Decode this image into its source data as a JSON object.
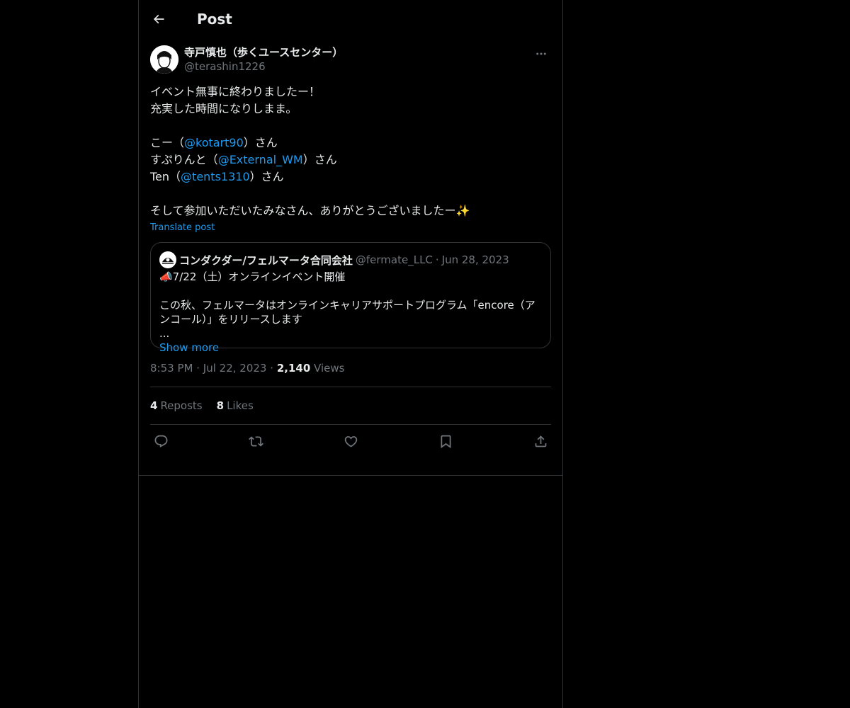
{
  "header": {
    "title": "Post"
  },
  "post": {
    "author": {
      "display_name": "寺戸慎也（歩くユースセンター）",
      "handle": "@terashin1226"
    },
    "body": {
      "line1": "イベント無事に終わりましたー！",
      "line2": "充実した時間になりしまま。",
      "thanks": [
        {
          "prefix": "こー（",
          "mention": "@kotart90",
          "suffix": "）さん"
        },
        {
          "prefix": "すぷりんと（",
          "mention": "@External_WM",
          "suffix": "）さん"
        },
        {
          "prefix": "Ten（",
          "mention": "@tents1310",
          "suffix": "）さん"
        }
      ],
      "closing": "そして参加いただいたみなさん、ありがとうございましたー✨"
    },
    "translate_label": "Translate post",
    "quote": {
      "name": "コンダクダー/フェルマータ合同会社",
      "handle": "@fermate_LLC",
      "separator": "·",
      "date": "Jun 28, 2023",
      "lines": [
        "📣7/22（土）オンラインイベント開催",
        "",
        "この秋、フェルマータはオンラインキャリアサポートプログラム「encore（ア",
        "ンコール）」をリリースします",
        "..."
      ],
      "show_more": "Show more"
    },
    "meta": {
      "time": "8:53 PM",
      "separator": "·",
      "date": "Jul 22, 2023",
      "views_count": "2,140",
      "views_label": "Views"
    },
    "stats": {
      "reposts_count": "4",
      "reposts_label": "Reposts",
      "likes_count": "8",
      "likes_label": "Likes"
    }
  },
  "icons": {
    "back": "arrow-left-icon",
    "more": "more-horizontal-icon",
    "reply": "reply-icon",
    "repost": "repost-icon",
    "like": "heart-icon",
    "bookmark": "bookmark-icon",
    "share": "share-icon"
  },
  "colors": {
    "background": "#000000",
    "text": "#e7e9ea",
    "muted": "#71767b",
    "link": "#1d9bf0",
    "border": "#2f3336"
  }
}
